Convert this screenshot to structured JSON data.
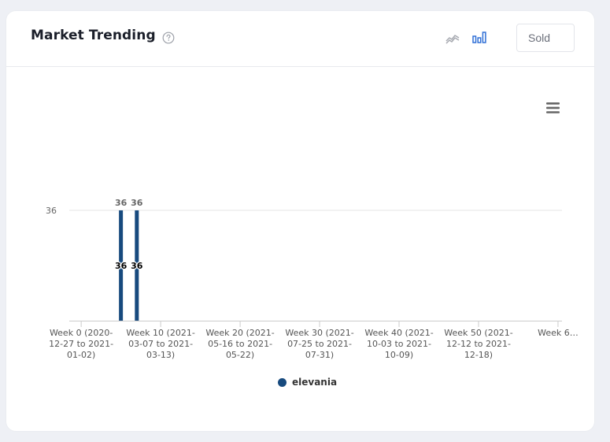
{
  "header": {
    "title": "Market Trending",
    "help_icon": "question-circle-icon",
    "line_chart_icon": "line-chart-icon",
    "bar_chart_icon": "bar-chart-icon",
    "select_value": "Sold"
  },
  "toolbar": {
    "menu_icon": "hamburger-menu-icon"
  },
  "colors": {
    "series": "#174a7e",
    "active_icon": "#2f6fd6",
    "inactive_icon": "#a6a9b0"
  },
  "chart_data": {
    "type": "bar",
    "categories": [
      "Week 0 (2020-12-27 to 2021-01-02)",
      "Week 10 (2021-03-07 to 2021-03-13)",
      "Week 20 (2021-05-16 to 2021-05-22)",
      "Week 30 (2021-07-25 to 2021-07-31)",
      "Week 40 (2021-10-03 to 2021-10-09)",
      "Week 50 (2021-12-12 to 2021-12-18)",
      "Week 6…"
    ],
    "tick_labels": [
      [
        "Week 0 (2020-",
        "12-27 to 2021-",
        "01-02)"
      ],
      [
        "Week 10 (2021-",
        "03-07 to 2021-",
        "03-13)"
      ],
      [
        "Week 20 (2021-",
        "05-16 to 2021-",
        "05-22)"
      ],
      [
        "Week 30 (2021-",
        "07-25 to 2021-",
        "07-31)"
      ],
      [
        "Week 40 (2021-",
        "10-03 to 2021-",
        "10-09)"
      ],
      [
        "Week 50 (2021-",
        "12-12 to 2021-",
        "12-18)"
      ],
      [
        "Week 6…"
      ]
    ],
    "tick_weeks": [
      0,
      10,
      20,
      30,
      40,
      50,
      60
    ],
    "series": [
      {
        "name": "elevania",
        "points": [
          {
            "week": 5,
            "value": 36
          },
          {
            "week": 7,
            "value": 36
          }
        ]
      }
    ],
    "y_ticks": [
      "36"
    ],
    "ylim": [
      0,
      36
    ],
    "x_range": [
      -1.5,
      60.5
    ],
    "grid": true,
    "legend": "bottom-center"
  }
}
